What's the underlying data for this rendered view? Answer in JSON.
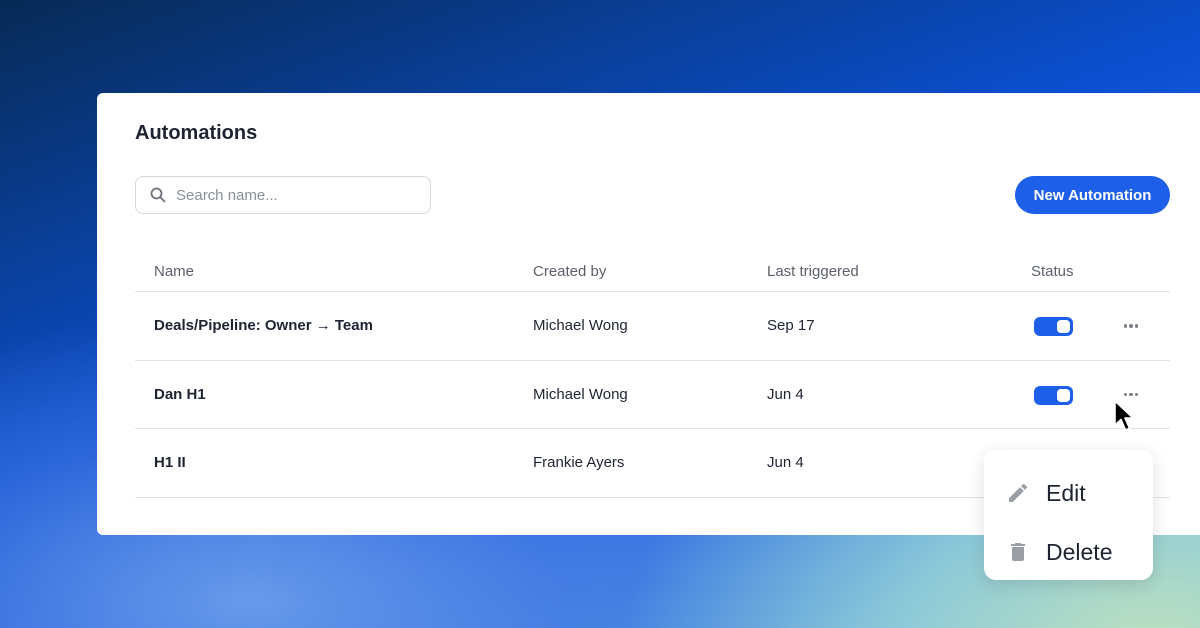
{
  "page": {
    "title": "Automations"
  },
  "search": {
    "placeholder": "Search name..."
  },
  "toolbar": {
    "new_label": "New Automation"
  },
  "table": {
    "headers": [
      "Name",
      "Created by",
      "Last triggered",
      "Status"
    ],
    "rows": [
      {
        "name": "Deals/Pipeline: Owner → Team",
        "created_by": "Michael Wong",
        "last_triggered": "Sep 17",
        "status_on": true
      },
      {
        "name": "Dan H1",
        "created_by": "Michael Wong",
        "last_triggered": "Jun 4",
        "status_on": true
      },
      {
        "name": "H1 II",
        "created_by": "Frankie Ayers",
        "last_triggered": "Jun 4",
        "status_on": null
      }
    ]
  },
  "menu": {
    "items": [
      {
        "label": "Edit",
        "icon": "pencil-icon"
      },
      {
        "label": "Delete",
        "icon": "trash-icon"
      }
    ]
  },
  "colors": {
    "accent": "#1d5fe8",
    "text": "#1f2433",
    "muted": "#5b606a"
  }
}
